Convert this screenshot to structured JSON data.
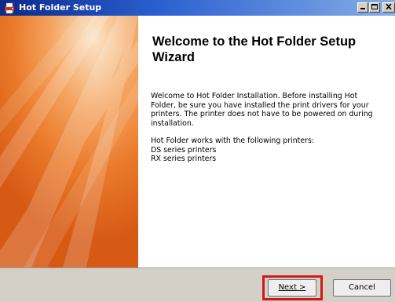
{
  "window": {
    "title": "Hot Folder Setup",
    "icons": {
      "app": "printer-app-icon",
      "minimize": "minimize-icon",
      "maximize": "maximize-icon",
      "close": "close-icon"
    },
    "colors": {
      "titlebar_start": "#0b2a8a",
      "titlebar_end": "#86aee6",
      "banner": "#ea7a2a",
      "highlight": "#d01a1a"
    }
  },
  "content": {
    "heading": "Welcome to the Hot Folder Setup Wizard",
    "paragraph1_lines": [
      "Welcome to Hot Folder Installation. Before installing Hot",
      "Folder, be sure you have installed the print drivers for your",
      "printers. The printer does not have to be powered on during",
      "installation."
    ],
    "paragraph2_lines": [
      "Hot Folder works with the following printers:",
      "DS series printers",
      "RX series printers"
    ]
  },
  "buttons": {
    "next": "Next >",
    "cancel": "Cancel"
  }
}
